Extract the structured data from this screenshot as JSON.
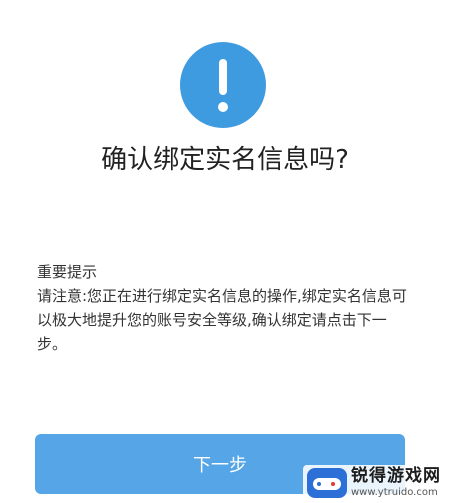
{
  "icons": {
    "alert": "exclamation-circle-icon",
    "watermark_logo": "gamepad-logo-icon"
  },
  "colors": {
    "accent": "#3f9be0",
    "button": "#56a5e6",
    "button_text": "#ffffff",
    "text": "#222222"
  },
  "dialog": {
    "title": "确认绑定实名信息吗?",
    "notice_heading": "重要提示",
    "notice_body": "请注意:您正在进行绑定实名信息的操作,绑定实名信息可以极大地提升您的账号安全等级,确认绑定请点击下一步。",
    "next_button": "下一步"
  },
  "watermark": {
    "name": "锐得游戏网",
    "url": "www.ytruido.com"
  }
}
